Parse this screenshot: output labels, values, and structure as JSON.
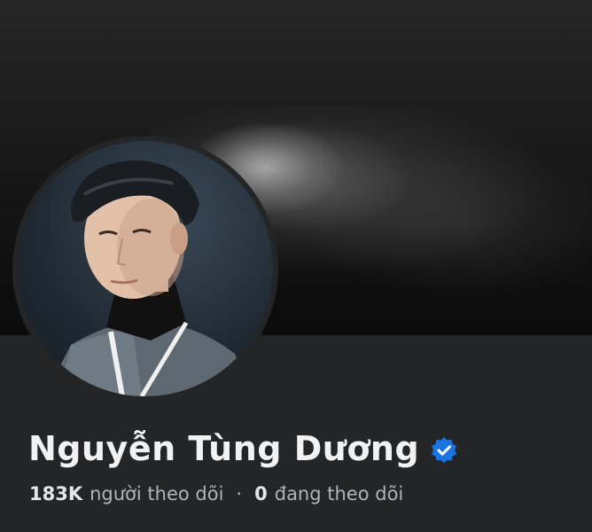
{
  "profile": {
    "name": "Nguyễn Tùng Dương",
    "verified": true,
    "followers_count": "183K",
    "followers_label": "người theo dõi",
    "separator": "·",
    "following_count": "0",
    "following_label": "đang theo dõi"
  },
  "colors": {
    "background": "#242526",
    "verified_badge": "#1b74e4",
    "name_text": "#f2f2f2",
    "secondary_text": "#b0b3b8"
  }
}
